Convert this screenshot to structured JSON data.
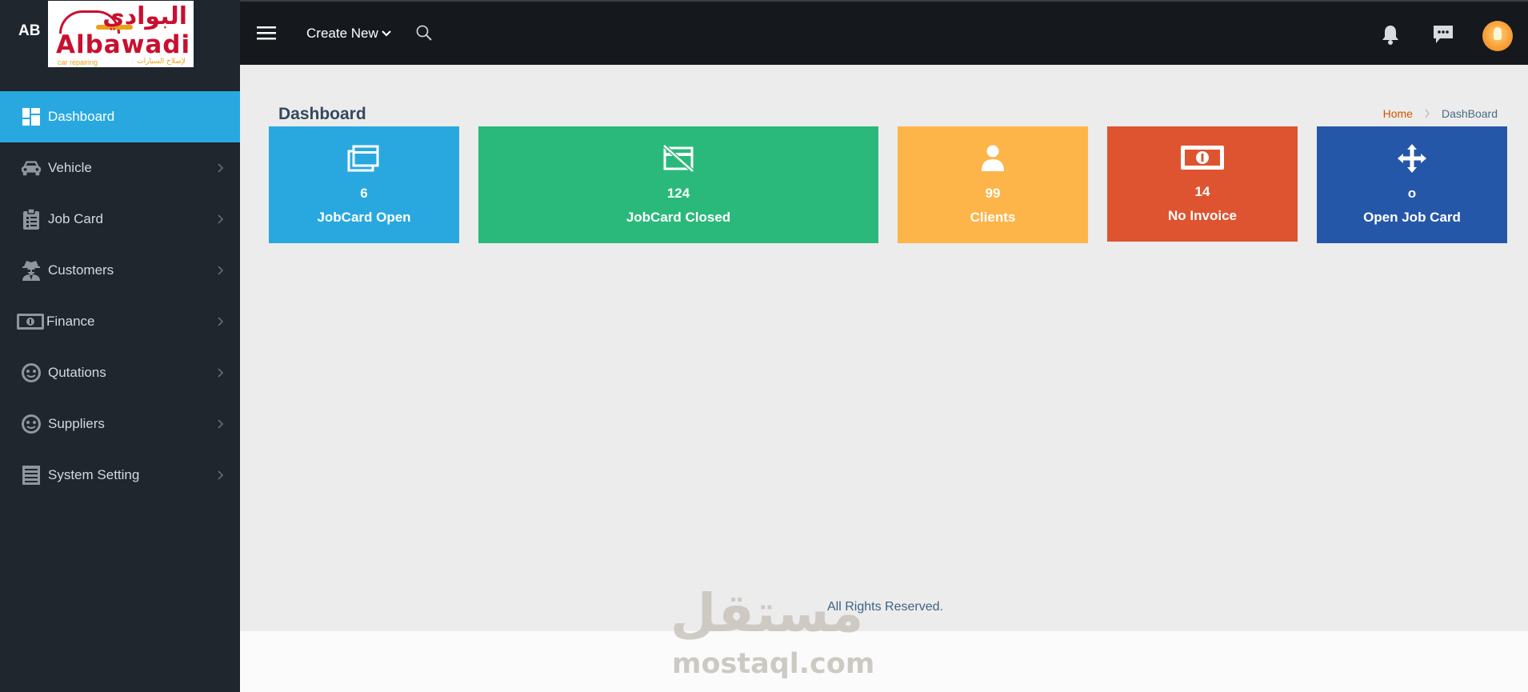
{
  "brand": {
    "abbr": "AB",
    "logo_arabic": "البوادي",
    "logo_latin": "Albawadi",
    "logo_sub": "car repairing",
    "logo_sub_arabic": "لإصلاح السيارات"
  },
  "topbar": {
    "create_new": "Create New"
  },
  "sidebar": {
    "items": [
      {
        "label": "Dashboard",
        "icon": "dashboard-icon",
        "active": true
      },
      {
        "label": "Vehicle",
        "icon": "car-icon"
      },
      {
        "label": "Job Card",
        "icon": "clipboard-icon"
      },
      {
        "label": "Customers",
        "icon": "user-secret-icon"
      },
      {
        "label": "Finance",
        "icon": "money-bill-icon"
      },
      {
        "label": "Qutations",
        "icon": "smile-icon"
      },
      {
        "label": "Suppliers",
        "icon": "smile-icon"
      },
      {
        "label": "System Setting",
        "icon": "list-icon"
      }
    ]
  },
  "main": {
    "title": "Dashboard",
    "breadcrumb": {
      "home": "Home",
      "current": "DashBoard"
    },
    "cards": [
      {
        "value": "6",
        "label": "JobCard Open",
        "color": "#29a8e0",
        "icon": "copy-icon"
      },
      {
        "value": "124",
        "label": "JobCard Closed",
        "color": "#2ab97a",
        "icon": "card-off-icon"
      },
      {
        "value": "99",
        "label": "Clients",
        "color": "#fdb54a",
        "icon": "user-icon"
      },
      {
        "value": "14",
        "label": "No Invoice",
        "color": "#df5430",
        "icon": "money-bill-icon"
      },
      {
        "value": "o",
        "label": "Open Job Card",
        "color": "#2557a8",
        "icon": "arrows-move-icon"
      }
    ]
  },
  "footer": {
    "text": "All Rights Reserved."
  },
  "watermark": {
    "arabic": "مستقل",
    "latin": "mostaql.com"
  }
}
